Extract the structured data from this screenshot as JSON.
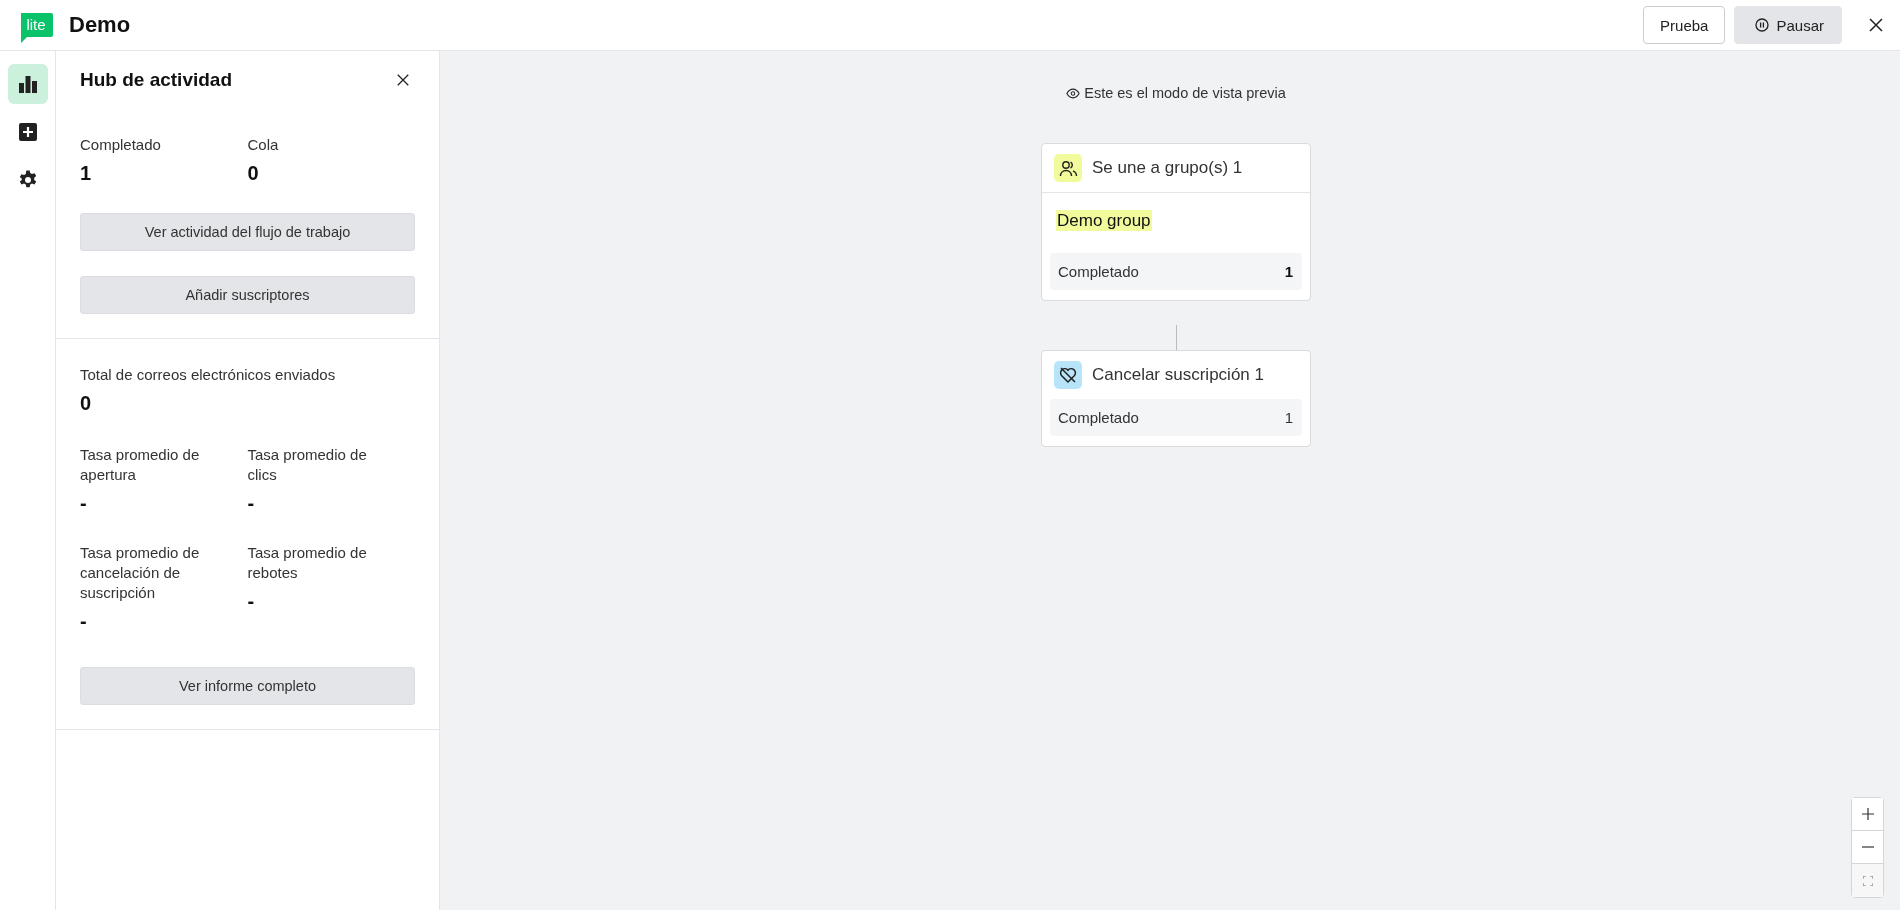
{
  "header": {
    "logo": "lite",
    "title": "Demo",
    "buttons": [
      {
        "label": "Prueba",
        "kind": "outline"
      },
      {
        "label": "Pausar",
        "kind": "pause"
      }
    ]
  },
  "rail": [
    {
      "kind": "chart",
      "selected": true
    },
    {
      "kind": "add",
      "selected": false
    },
    {
      "kind": "settings",
      "selected": false
    }
  ],
  "panel": {
    "title": "Hub de actividad",
    "counts": [
      {
        "label": "Completado",
        "value": "1"
      },
      {
        "label": "Cola",
        "value": "0"
      }
    ],
    "actions": [
      "Ver actividad del flujo de trabajo",
      "Añadir suscriptores"
    ],
    "total": {
      "label": "Total de correos electrónicos enviados",
      "value": "0"
    },
    "rates": [
      {
        "label": "Tasa promedio de apertura",
        "value": "-"
      },
      {
        "label": "Tasa promedio de clics",
        "value": "-"
      },
      {
        "label": "Tasa promedio de cancelación de suscripción",
        "value": "-"
      },
      {
        "label": "Tasa promedio de rebotes",
        "value": "-"
      }
    ],
    "report_button": "Ver informe completo"
  },
  "canvas": {
    "notice": "Este es el modo de vista previa",
    "nodes": [
      {
        "kind": "group",
        "title": "Se une a grupo(s) 1",
        "tag": "Demo group",
        "stat_label": "Completado",
        "stat_value": "1"
      },
      {
        "kind": "unsubscribe",
        "title": "Cancelar suscripción 1",
        "stat_label": "Completado",
        "stat_value": "1"
      }
    ]
  }
}
